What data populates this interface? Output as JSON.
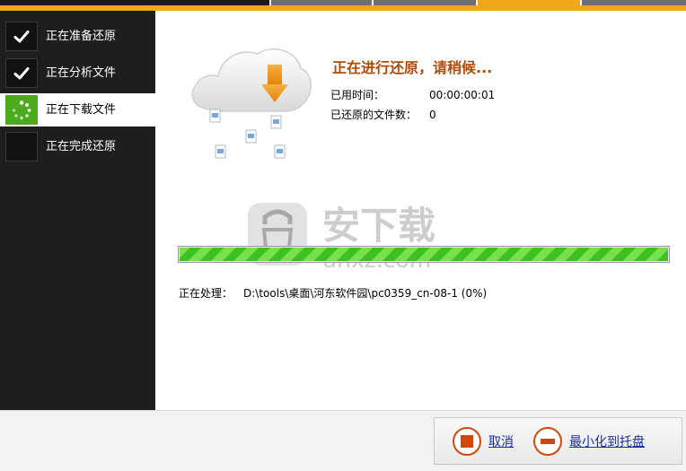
{
  "steps": [
    {
      "label": "正在准备还原",
      "state": "done"
    },
    {
      "label": "正在分析文件",
      "state": "done"
    },
    {
      "label": "正在下载文件",
      "state": "active"
    },
    {
      "label": "正在完成还原",
      "state": "pending"
    }
  ],
  "status": {
    "title": "正在进行还原，请稍候...",
    "elapsed_label": "已用时间：",
    "elapsed_value": "00:00:00:01",
    "restored_label": "已还原的文件数：",
    "restored_value": "0"
  },
  "progress": {
    "fraction": 1.0
  },
  "processing": {
    "label": "正在处理：",
    "path": "D:\\tools\\桌面\\河东软件园\\pc0359_cn-08-1 (0%)"
  },
  "watermark": {
    "text_cn": "安下载",
    "text_en": "anxz.com"
  },
  "buttons": {
    "cancel": "取消",
    "minimize": "最小化到托盘"
  },
  "colors": {
    "accent": "#f0a818",
    "title": "#b24a08",
    "active_step": "#4caa1c",
    "progress": "#3cc21e",
    "button_icon": "#d2480c",
    "link": "#1a2fa0"
  },
  "icons": {
    "done": "checkmark-icon",
    "active": "spinner-icon",
    "cloud": "cloud-download-icon",
    "cancel": "stop-icon",
    "minimize": "minus-icon"
  }
}
